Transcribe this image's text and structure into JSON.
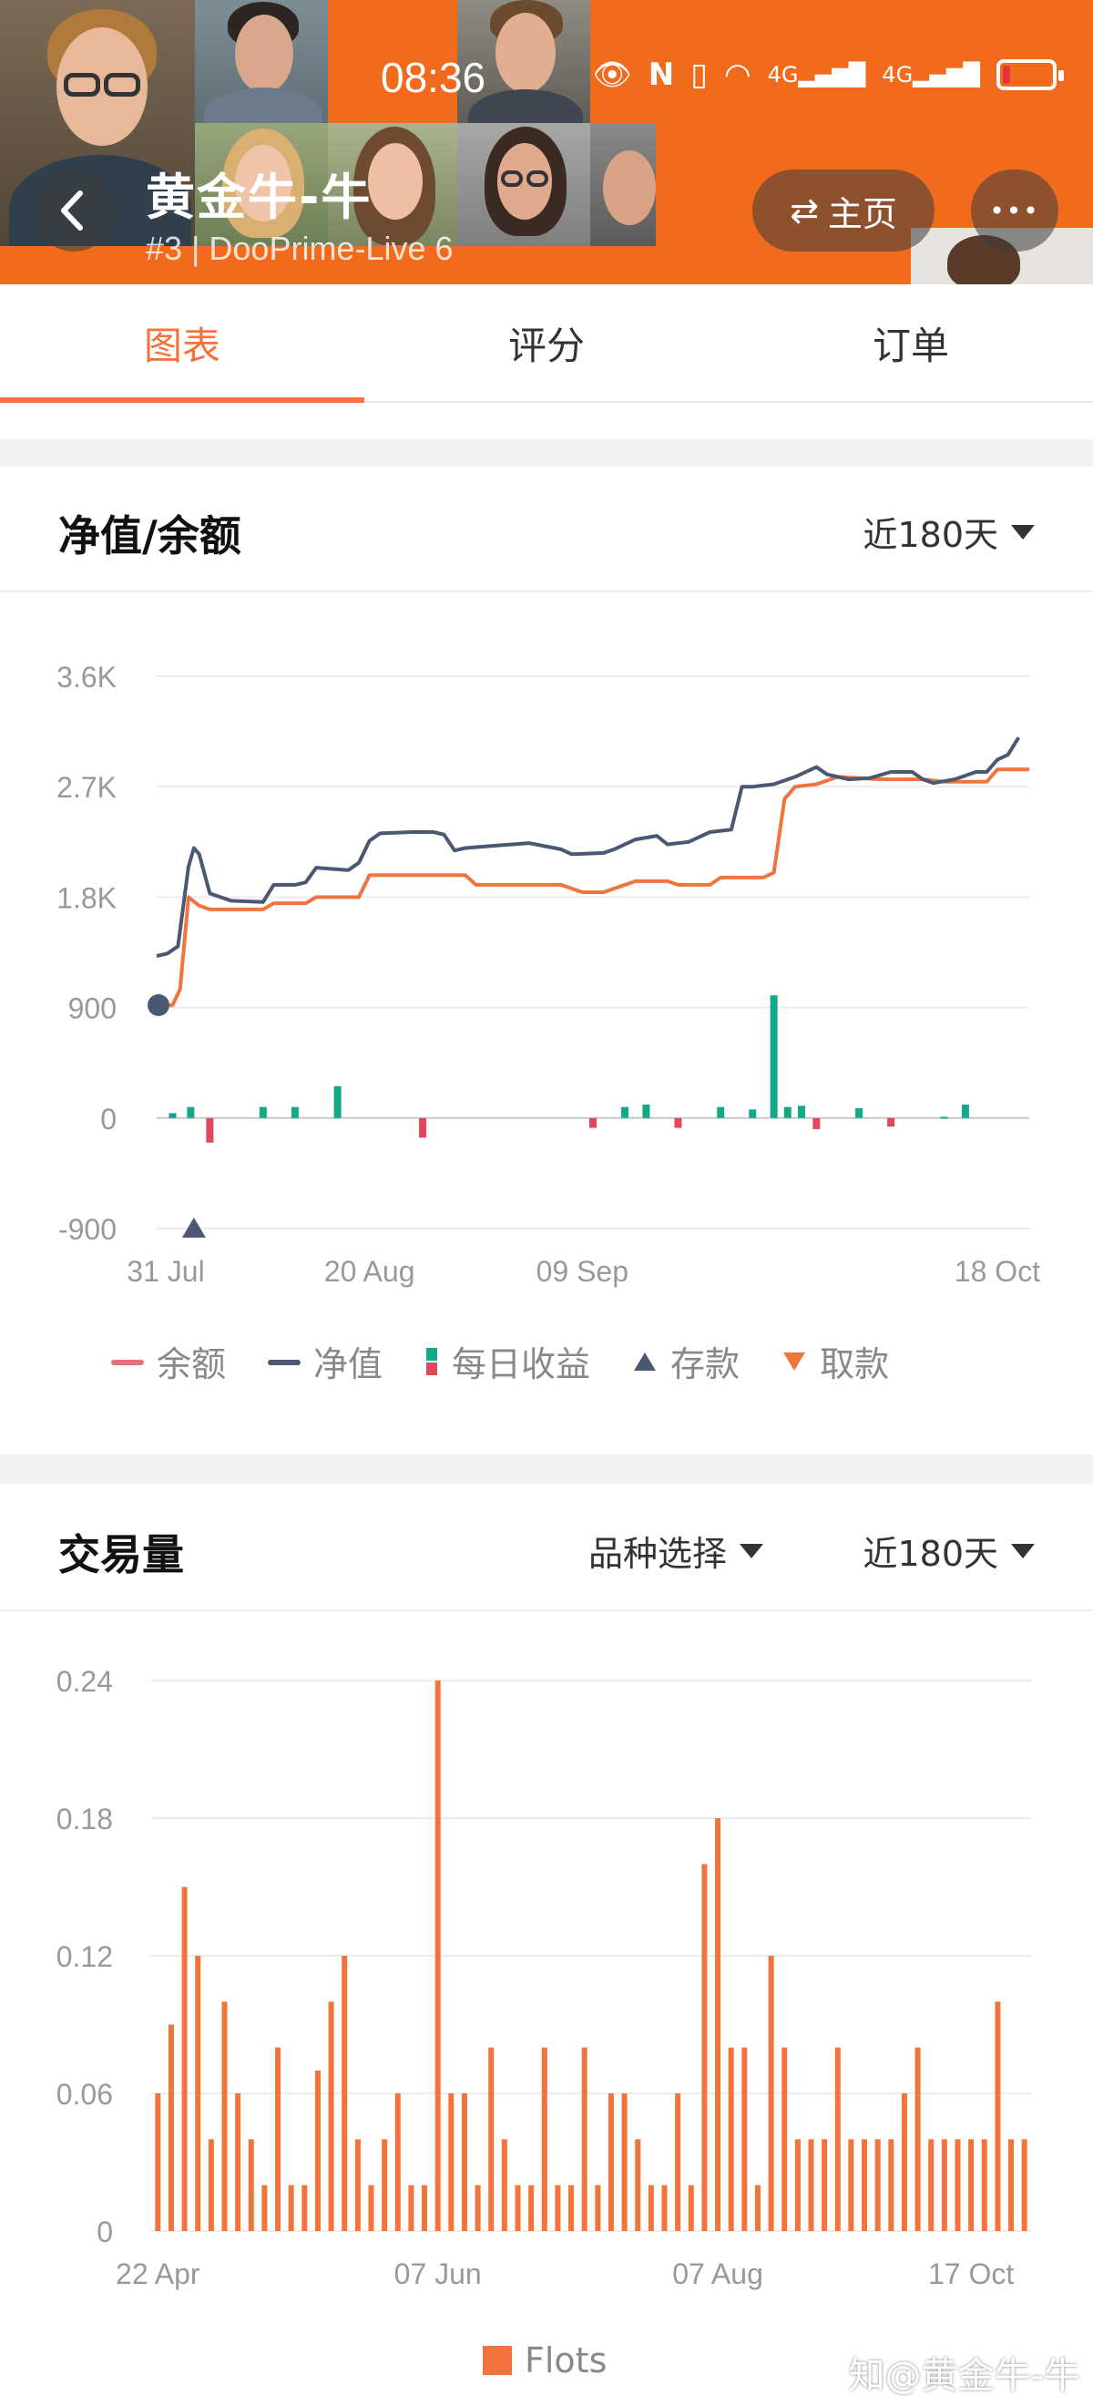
{
  "status_bar": {
    "time": "08:36"
  },
  "header": {
    "title": "黄金牛-牛",
    "subtitle": "#3 | DooPrime-Live 6",
    "home_label": "主页",
    "more_label": "•••"
  },
  "tabs": [
    {
      "label": "图表",
      "active": true
    },
    {
      "label": "评分",
      "active": false
    },
    {
      "label": "订单",
      "active": false
    }
  ],
  "equity_card": {
    "title": "净值/余额",
    "period": "近180天",
    "legend": [
      {
        "label": "余额",
        "icon": "dash",
        "color": "#e8707a"
      },
      {
        "label": "净值",
        "icon": "dash",
        "color": "#4a5872"
      },
      {
        "label": "每日收益",
        "icon": "bars",
        "color": "#13a887"
      },
      {
        "label": "存款",
        "icon": "triangle-up",
        "color": "#4a5872"
      },
      {
        "label": "取款",
        "icon": "triangle-down",
        "color": "#f0743b"
      }
    ]
  },
  "volume_card": {
    "title": "交易量",
    "variety_filter": "品种选择",
    "period": "近180天",
    "legend": [
      {
        "label": "Flots",
        "color": "#f0743b"
      }
    ]
  },
  "chart_data": [
    {
      "type": "line",
      "y_tick_labels": [
        "3.6K",
        "2.7K",
        "1.8K",
        "900",
        "0",
        "-900"
      ],
      "y_ticks": [
        3600,
        2700,
        1800,
        900,
        0,
        -900
      ],
      "ylim": [
        -900,
        3600
      ],
      "x_tick_labels": [
        "31 Jul",
        "20 Aug",
        "09 Sep",
        "18 Oct"
      ],
      "x_ticks": [
        0,
        20,
        40,
        79
      ],
      "xlim": [
        0,
        82
      ],
      "series": [
        {
          "name": "余额",
          "color": "#f0743b",
          "points": [
            [
              0,
              920
            ],
            [
              1.5,
              920
            ],
            [
              2.2,
              1050
            ],
            [
              3,
              1800
            ],
            [
              4,
              1730
            ],
            [
              5,
              1700
            ],
            [
              7,
              1700
            ],
            [
              10,
              1700
            ],
            [
              11,
              1750
            ],
            [
              14,
              1750
            ],
            [
              15,
              1800
            ],
            [
              19,
              1800
            ],
            [
              20,
              1980
            ],
            [
              26,
              1980
            ],
            [
              29,
              1980
            ],
            [
              30,
              1900
            ],
            [
              38,
              1900
            ],
            [
              40,
              1840
            ],
            [
              42,
              1840
            ],
            [
              45,
              1930
            ],
            [
              48,
              1930
            ],
            [
              49,
              1900
            ],
            [
              52,
              1900
            ],
            [
              53,
              1960
            ],
            [
              57,
              1960
            ],
            [
              58,
              2000
            ],
            [
              59,
              2600
            ],
            [
              60,
              2700
            ],
            [
              62,
              2720
            ],
            [
              64,
              2780
            ],
            [
              68,
              2760
            ],
            [
              72,
              2760
            ],
            [
              74,
              2740
            ],
            [
              78,
              2740
            ],
            [
              79,
              2840
            ],
            [
              82,
              2840
            ]
          ]
        },
        {
          "name": "净值",
          "color": "#4a5872",
          "points": [
            [
              0,
              1320
            ],
            [
              1,
              1340
            ],
            [
              2,
              1400
            ],
            [
              3,
              2050
            ],
            [
              3.5,
              2200
            ],
            [
              4,
              2150
            ],
            [
              5,
              1830
            ],
            [
              6,
              1800
            ],
            [
              7,
              1770
            ],
            [
              10,
              1760
            ],
            [
              11,
              1900
            ],
            [
              13,
              1900
            ],
            [
              14,
              1920
            ],
            [
              15,
              2040
            ],
            [
              18,
              2020
            ],
            [
              19,
              2080
            ],
            [
              20,
              2260
            ],
            [
              21,
              2320
            ],
            [
              24,
              2330
            ],
            [
              26,
              2330
            ],
            [
              27,
              2310
            ],
            [
              28,
              2180
            ],
            [
              29,
              2200
            ],
            [
              32,
              2220
            ],
            [
              35,
              2240
            ],
            [
              38,
              2190
            ],
            [
              39,
              2150
            ],
            [
              42,
              2160
            ],
            [
              43,
              2190
            ],
            [
              45,
              2270
            ],
            [
              47,
              2300
            ],
            [
              48,
              2230
            ],
            [
              50,
              2250
            ],
            [
              52,
              2330
            ],
            [
              54,
              2350
            ],
            [
              55,
              2700
            ],
            [
              56,
              2700
            ],
            [
              58,
              2720
            ],
            [
              60,
              2780
            ],
            [
              62,
              2860
            ],
            [
              63,
              2800
            ],
            [
              65,
              2760
            ],
            [
              67,
              2770
            ],
            [
              69,
              2820
            ],
            [
              71,
              2820
            ],
            [
              72,
              2760
            ],
            [
              73,
              2730
            ],
            [
              75,
              2760
            ],
            [
              77,
              2820
            ],
            [
              78,
              2820
            ],
            [
              79,
              2920
            ],
            [
              80,
              2960
            ],
            [
              81,
              3100
            ]
          ]
        },
        {
          "name": "每日收益",
          "color_pos": "#13a887",
          "color_neg": "#e0485e",
          "bars": [
            [
              1.5,
              40
            ],
            [
              3.2,
              90
            ],
            [
              5,
              -200
            ],
            [
              10,
              90
            ],
            [
              13,
              90
            ],
            [
              17,
              260
            ],
            [
              25,
              -160
            ],
            [
              41,
              -80
            ],
            [
              44,
              90
            ],
            [
              46,
              110
            ],
            [
              49,
              -80
            ],
            [
              53,
              90
            ],
            [
              56,
              70
            ],
            [
              58,
              1000
            ],
            [
              59.3,
              90
            ],
            [
              60.6,
              100
            ],
            [
              62,
              -90
            ],
            [
              66,
              80
            ],
            [
              69,
              -70
            ],
            [
              74,
              10
            ],
            [
              76,
              110
            ]
          ]
        },
        {
          "name": "存款",
          "color": "#4a5872",
          "points": [
            [
              3.5,
              -900
            ]
          ]
        },
        {
          "name": "deposit-start-dot",
          "color": "#4a5872",
          "points": [
            [
              0,
              920
            ]
          ]
        }
      ]
    },
    {
      "type": "bar",
      "y_tick_labels": [
        "0.24",
        "0.18",
        "0.12",
        "0.06",
        "0"
      ],
      "y_ticks": [
        0.24,
        0.18,
        0.12,
        0.06,
        0
      ],
      "ylim": [
        0,
        0.24
      ],
      "x_tick_labels": [
        "22 Apr",
        "07 Jun",
        "07 Aug",
        "17 Oct"
      ],
      "x_tick_index": [
        0,
        21,
        42,
        61
      ],
      "series": [
        {
          "name": "Flots",
          "color": "#f0743b",
          "values": [
            0.06,
            0.09,
            0.15,
            0.12,
            0.04,
            0.1,
            0.06,
            0.04,
            0.02,
            0.08,
            0.02,
            0.02,
            0.07,
            0.1,
            0.12,
            0.04,
            0.02,
            0.04,
            0.06,
            0.02,
            0.02,
            0.24,
            0.06,
            0.06,
            0.02,
            0.08,
            0.04,
            0.02,
            0.02,
            0.08,
            0.02,
            0.02,
            0.08,
            0.02,
            0.06,
            0.06,
            0.04,
            0.02,
            0.02,
            0.06,
            0.02,
            0.16,
            0.18,
            0.08,
            0.08,
            0.02,
            0.12,
            0.08,
            0.04,
            0.04,
            0.04,
            0.08,
            0.04,
            0.04,
            0.04,
            0.04,
            0.06,
            0.08,
            0.04,
            0.04,
            0.04,
            0.04,
            0.04,
            0.1,
            0.04,
            0.04
          ]
        }
      ]
    }
  ],
  "watermark": "知@黄金牛-牛"
}
